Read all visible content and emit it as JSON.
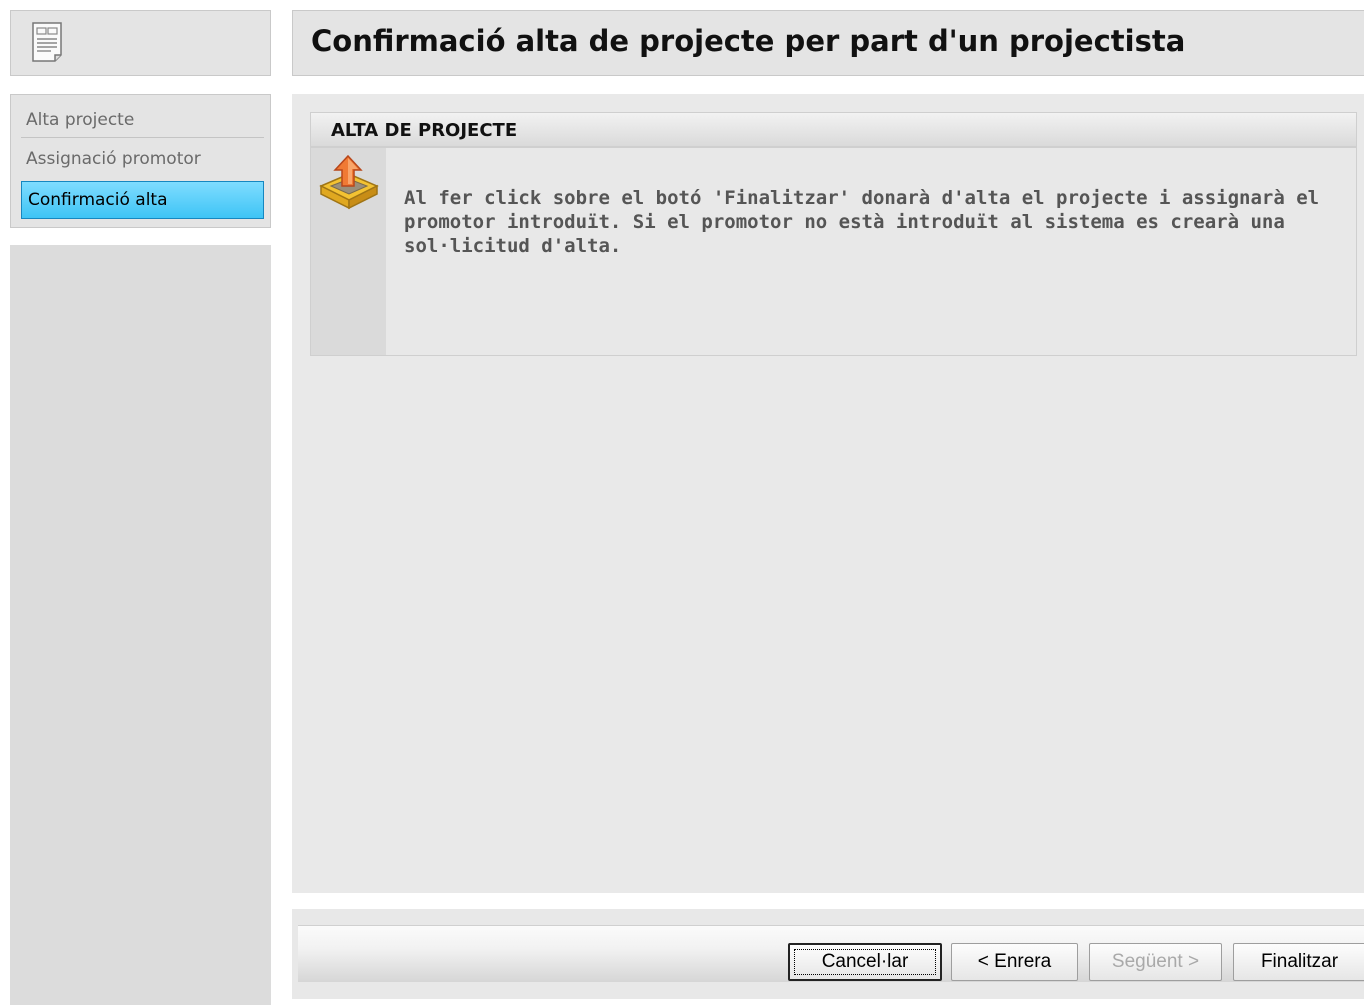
{
  "header": {
    "title": "Confirmació alta de projecte per part d'un projectista"
  },
  "steps": [
    {
      "label": "Alta projecte",
      "state": "done"
    },
    {
      "label": "Assignació promotor",
      "state": "done"
    },
    {
      "label": "Confirmació alta",
      "state": "active"
    }
  ],
  "section": {
    "title": "ALTA DE PROJECTE",
    "icon": "upload-tray-icon",
    "message": "Al fer click sobre el botó 'Finalitzar' donarà d'alta el projecte i assignarà el promotor introduït. Si el promotor no està introduït al sistema es crearà una sol·licitud d'alta."
  },
  "buttons": {
    "cancel": "Cancel·lar",
    "back": "< Enrera",
    "next": "Següent >",
    "finish": "Finalitzar"
  },
  "colors": {
    "active_step": "#3ec4f5",
    "panel_bg": "#e4e4e4"
  }
}
